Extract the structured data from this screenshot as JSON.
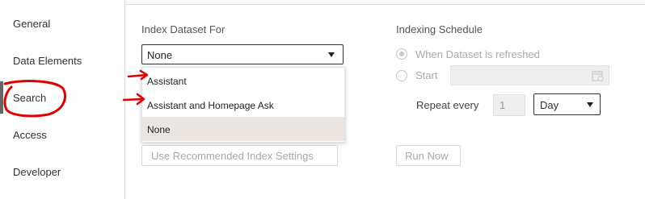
{
  "sidebar": {
    "items": [
      {
        "label": "General",
        "active": false
      },
      {
        "label": "Data Elements",
        "active": false
      },
      {
        "label": "Search",
        "active": true
      },
      {
        "label": "Access",
        "active": false
      },
      {
        "label": "Developer",
        "active": false
      }
    ]
  },
  "index_dataset": {
    "heading": "Index Dataset For",
    "selected": "None",
    "options": [
      {
        "label": "Assistant",
        "selected": false
      },
      {
        "label": "Assistant and Homepage Ask",
        "selected": false
      },
      {
        "label": "None",
        "selected": true
      }
    ],
    "recommended_button": "Use Recommended Index Settings"
  },
  "schedule": {
    "heading": "Indexing Schedule",
    "option_refresh": "When Dataset is refreshed",
    "option_start": "Start",
    "start_value": "",
    "repeat_label": "Repeat every",
    "repeat_value": "1",
    "repeat_unit": "Day",
    "run_now": "Run Now"
  },
  "annotations": {
    "color": "#e00000"
  }
}
